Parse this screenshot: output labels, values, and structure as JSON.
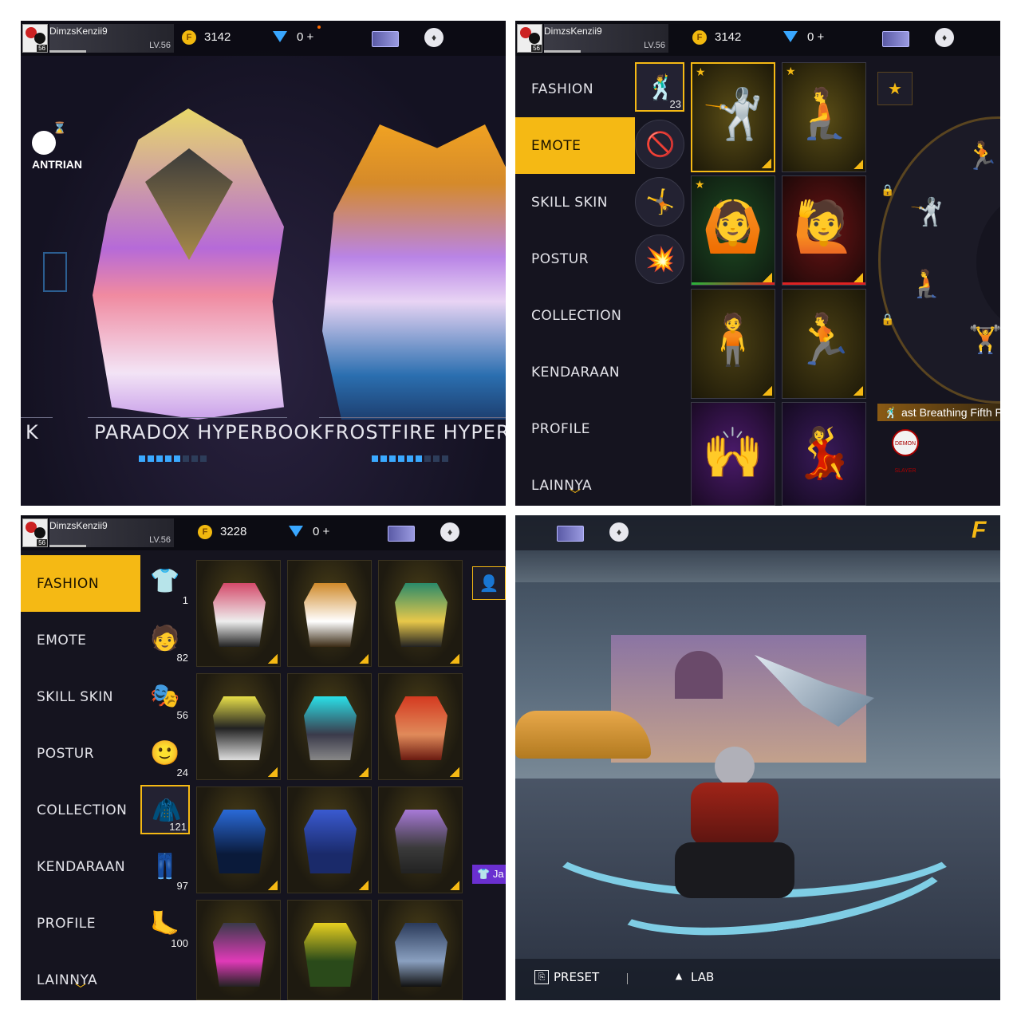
{
  "player": {
    "name": "DimzsKenzii9",
    "level": "LV.56",
    "avatar_level": "56"
  },
  "panel1": {
    "coins": "3142",
    "diamonds": "0",
    "queue_label": "ANTRIAN",
    "left_partial": "K",
    "books": [
      {
        "name": "PARADOX HYPERBOOK",
        "pips_on": 5,
        "pips_total": 8
      },
      {
        "name": "FROSTFIRE HYPERBOO",
        "pips_on": 6,
        "pips_total": 9
      }
    ]
  },
  "panel2": {
    "coins": "3142",
    "diamonds": "0",
    "menu": [
      "FASHION",
      "EMOTE",
      "SKILL SKIN",
      "POSTUR",
      "COLLECTION",
      "KENDARAAN",
      "PROFILE",
      "LAINNYA"
    ],
    "active_menu": "EMOTE",
    "sub_count": "23",
    "equipped_emote": "ast Breathing Fifth F",
    "badge_text": "DEMON SLAYER"
  },
  "panel3": {
    "coins": "3228",
    "diamonds": "0",
    "menu": [
      "FASHION",
      "EMOTE",
      "SKILL SKIN",
      "POSTUR",
      "COLLECTION",
      "KENDARAAN",
      "PROFILE",
      "LAINNYA"
    ],
    "active_menu": "FASHION",
    "categories": [
      "1",
      "82",
      "56",
      "24",
      "121",
      "97",
      "100"
    ],
    "tag_label": "Ja"
  },
  "panel4": {
    "preset_label": "PRESET",
    "lab_label": "LAB",
    "brand_letter": "F"
  },
  "icons": {
    "coin": "coin-icon",
    "diamond": "diamond-icon",
    "plus": "+"
  },
  "colors": {
    "accent": "#f5b914",
    "diamond": "#39a7ff",
    "background": "#151421"
  }
}
